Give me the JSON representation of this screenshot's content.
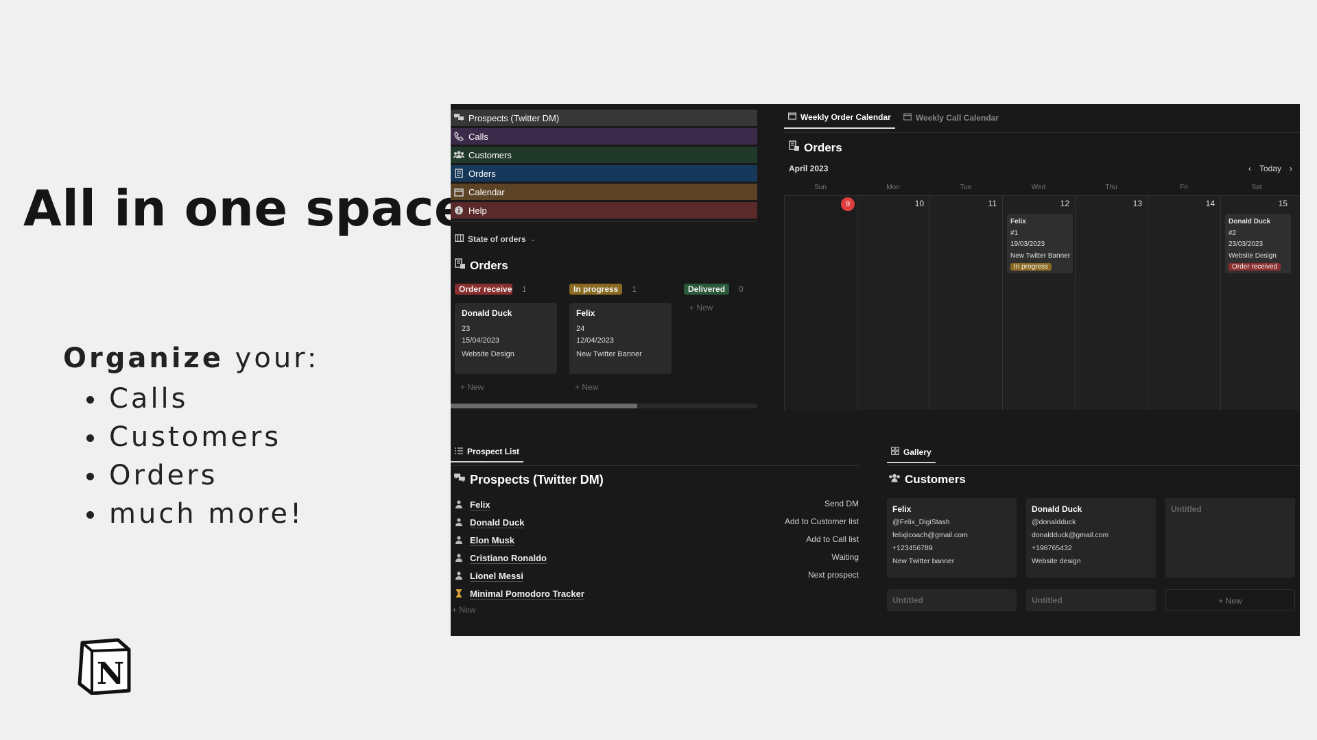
{
  "hero": {
    "title": "All in one space!"
  },
  "organize": {
    "bold": "Organize",
    "rest": " your:",
    "items": [
      "Calls",
      "Customers",
      "Orders",
      "much more!"
    ]
  },
  "logo": {
    "letter": "N"
  },
  "colors": {
    "prospects": "#373737",
    "calls": "#3c2a4a",
    "customers": "#21392a",
    "orders": "#16385a",
    "calendar": "#5c4326",
    "help": "#5a2a2b",
    "order_received": "#8a2f2f",
    "in_progress": "#8b6a22",
    "delivered": "#2b5a3b"
  },
  "nav": [
    {
      "label": "Prospects (Twitter DM)",
      "icon": "chat-icon"
    },
    {
      "label": "Calls",
      "icon": "phone-icon"
    },
    {
      "label": "Customers",
      "icon": "users-icon"
    },
    {
      "label": "Orders",
      "icon": "receipt-icon"
    },
    {
      "label": "Calendar",
      "icon": "calendar-icon"
    },
    {
      "label": "Help",
      "icon": "info-icon"
    }
  ],
  "board": {
    "view_tab": "State of orders",
    "title": "Orders",
    "columns": [
      {
        "status": "Order received",
        "count": "1",
        "cards": [
          {
            "name": "Donald Duck",
            "number": "23",
            "date": "15/04/2023",
            "service": "Website Design"
          }
        ]
      },
      {
        "status": "In progress",
        "count": "1",
        "cards": [
          {
            "name": "Felix",
            "number": "24",
            "date": "12/04/2023",
            "service": "New Twitter Banner"
          }
        ]
      },
      {
        "status": "Delivered",
        "count": "0",
        "cards": []
      }
    ],
    "new_label": "New"
  },
  "calendar": {
    "tabs": [
      "Weekly Order Calendar",
      "Weekly Call Calendar"
    ],
    "title": "Orders",
    "month": "April 2023",
    "today_label": "Today",
    "weekdays": [
      "Sun",
      "Mon",
      "Tue",
      "Wed",
      "Thu",
      "Fri",
      "Sat"
    ],
    "days": [
      "9",
      "10",
      "11",
      "12",
      "13",
      "14",
      "15"
    ],
    "events": [
      {
        "name": "Felix",
        "number": "#1",
        "date": "19/03/2023",
        "service": "New Twitter Banner",
        "status": "In progress"
      },
      {
        "name": "Donald Duck",
        "number": "#2",
        "date": "23/03/2023",
        "service": "Website Design",
        "status": "Order received"
      }
    ]
  },
  "prospects": {
    "tab": "Prospect List",
    "title": "Prospects (Twitter DM)",
    "rows": [
      {
        "name": "Felix",
        "status": "Send DM"
      },
      {
        "name": "Donald Duck",
        "status": "Add to Customer list"
      },
      {
        "name": "Elon Musk",
        "status": "Add to Call list"
      },
      {
        "name": "Cristiano Ronaldo",
        "status": "Waiting"
      },
      {
        "name": "Lionel Messi",
        "status": "Next prospect"
      },
      {
        "name": "Minimal Pomodoro Tracker",
        "status": ""
      }
    ],
    "new_label": "New"
  },
  "customers": {
    "tab": "Gallery",
    "title": "Customers",
    "cards": [
      {
        "name": "Felix",
        "handle": "@Felix_DigiStash",
        "email": "felixjlcoach@gmail.com",
        "phone": "+123456789",
        "service": "New Twitter banner"
      },
      {
        "name": "Donald Duck",
        "handle": "@donaldduck",
        "email": "donaldduck@gmail.com",
        "phone": "+198765432",
        "service": "Website design"
      }
    ],
    "untitled": "Untitled",
    "new_label": "New"
  }
}
